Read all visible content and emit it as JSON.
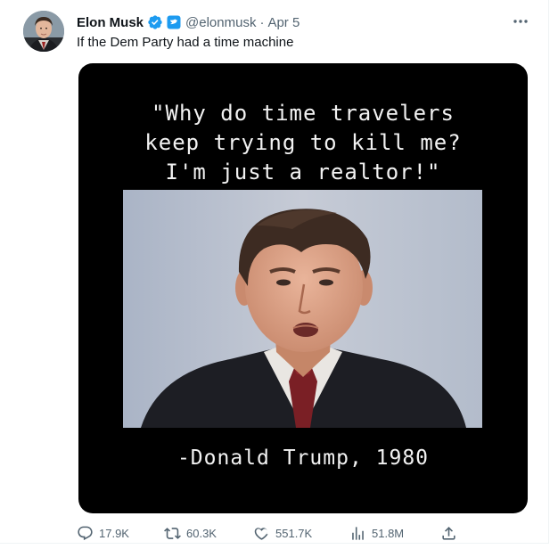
{
  "author": {
    "name": "Elon Musk",
    "handle": "@elonmusk",
    "separator": "·",
    "date": "Apr 5"
  },
  "tweet": {
    "text": "If the Dem Party had a time machine"
  },
  "media": {
    "quote_lines": [
      "\"Why do time travelers",
      "keep trying to kill me?",
      "I'm just a realtor!\""
    ],
    "attribution": "-Donald Trump, 1980"
  },
  "actions": {
    "replies": "17.9K",
    "reposts": "60.3K",
    "likes": "551.7K",
    "views": "51.8M"
  },
  "icons": {
    "verified": "verified-badge-icon",
    "affiliate": "affiliate-badge-icon",
    "more": "more-icon",
    "reply": "reply-icon",
    "repost": "repost-icon",
    "like": "like-icon",
    "views": "views-icon",
    "share": "share-icon"
  },
  "colors": {
    "verified_blue": "#1d9bf0",
    "text_primary": "#0f1419",
    "text_secondary": "#536471",
    "media_background": "#000000",
    "affiliate_badge": "#1d9bf0"
  }
}
